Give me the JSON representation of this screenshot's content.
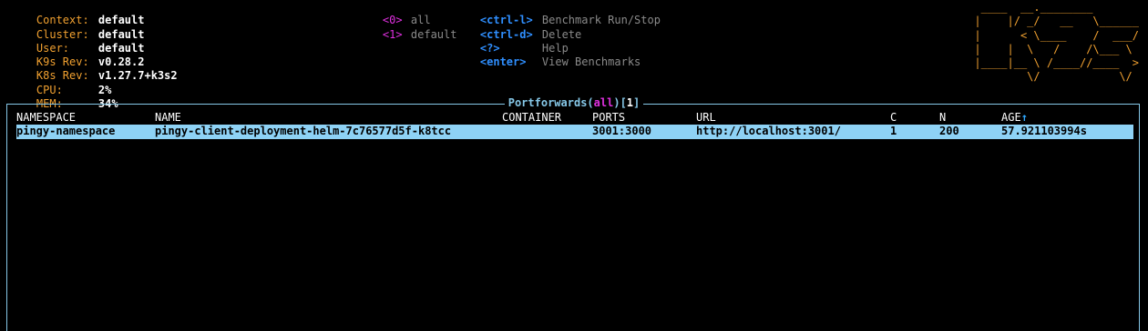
{
  "cluster_info": [
    {
      "key": "Context:",
      "value": "default"
    },
    {
      "key": "Cluster:",
      "value": "default"
    },
    {
      "key": "User:",
      "value": "default"
    },
    {
      "key": "K9s Rev:",
      "value": "v0.28.2"
    },
    {
      "key": "K8s Rev:",
      "value": "v1.27.7+k3s2"
    },
    {
      "key": "CPU:",
      "value": "2%"
    },
    {
      "key": "MEM:",
      "value": "34%"
    }
  ],
  "namespace_shortcuts": [
    {
      "key": "<0>",
      "label": "all"
    },
    {
      "key": "<1>",
      "label": "default"
    }
  ],
  "key_hints": [
    {
      "key": "<ctrl-l>",
      "label": "Benchmark Run/Stop"
    },
    {
      "key": "<ctrl-d>",
      "label": "Delete"
    },
    {
      "key": "<?>",
      "label": "Help"
    },
    {
      "key": "<enter>",
      "label": "View Benchmarks"
    }
  ],
  "logo_ascii": " ____  __.________\n|    |/ _/   __   \\______\n|      < \\____    /  ___/\n|    |  \\   /    /\\___ \\\n|____|__ \\ /____//____  >\n        \\/            \\/",
  "table": {
    "title": "Portforwards",
    "filter": "all",
    "count": "1",
    "columns": {
      "namespace": "NAMESPACE",
      "name": "NAME",
      "container": "CONTAINER",
      "ports": "PORTS",
      "url": "URL",
      "c": "C",
      "n": "N",
      "age": "AGE",
      "age_sort": "↑"
    },
    "rows": [
      {
        "namespace": "pingy-namespace",
        "name": "pingy-client-deployment-helm-7c76577d5f-k8tcc",
        "container": "",
        "ports": "3001:3000",
        "url": "http://localhost:3001/",
        "c": "1",
        "n": "200",
        "age": "57.921103994s"
      }
    ]
  },
  "colors": {
    "background": "#000000",
    "info_key": "#f0a030",
    "namespace_key": "#e030e0",
    "hint_key": "#2f8fff",
    "hint_label": "#8a8a8a",
    "frame_border": "#86c8e8",
    "selected_row": "#8ed2f5"
  }
}
